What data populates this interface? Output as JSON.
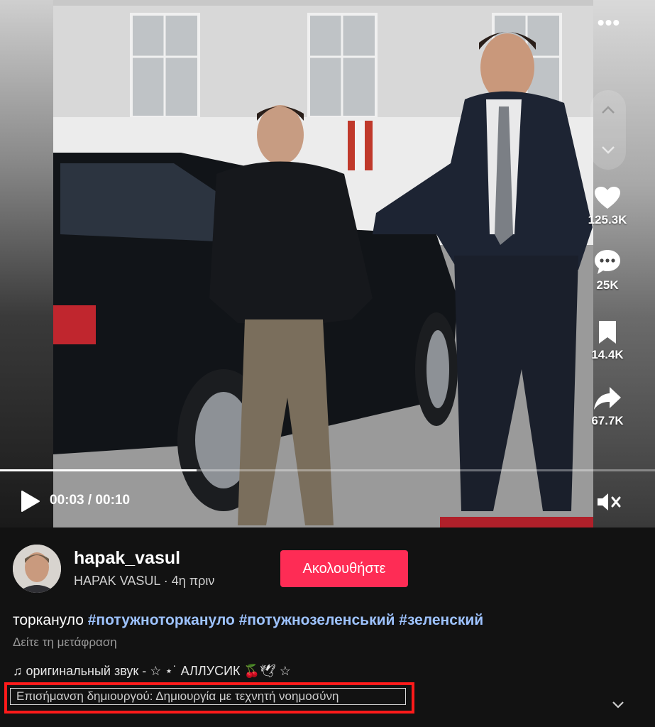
{
  "video": {
    "current_time": "00:03",
    "duration": "00:10",
    "time_display": "00:03 / 00:10",
    "progress_fraction": 0.3
  },
  "actions": {
    "likes": "125.3K",
    "comments": "25K",
    "saves": "14.4K",
    "shares": "67.7K"
  },
  "creator": {
    "username": "hapak_vasul",
    "display_name": "HAPAK VASUL",
    "age": "4η πριν",
    "subline": "HAPAK VASUL · 4η πριν"
  },
  "follow_label": "Ακολουθήστε",
  "caption": {
    "text": "торкануло",
    "hashtags": [
      "#потужноторкануло",
      "#потужнозеленський",
      "#зеленский"
    ]
  },
  "translate_label": "Δείτε τη μετάφραση",
  "music": "♫ оригинальный звук - ☆ ⋆˙ АЛЛУСИК 🍒🕊 ☆",
  "creator_label": "Επισήμανση δημιουργού: Δημιουργία με τεχνητή νοημοσύνη",
  "colors": {
    "follow": "#fe2c55",
    "hashtag": "#9ec3ff",
    "highlight": "#ff1a1a",
    "background": "#121212"
  },
  "icons": [
    "more-icon",
    "chevron-up-icon",
    "chevron-down-icon",
    "heart-icon",
    "comment-icon",
    "bookmark-icon",
    "share-icon",
    "play-icon",
    "mute-icon",
    "expand-icon"
  ]
}
